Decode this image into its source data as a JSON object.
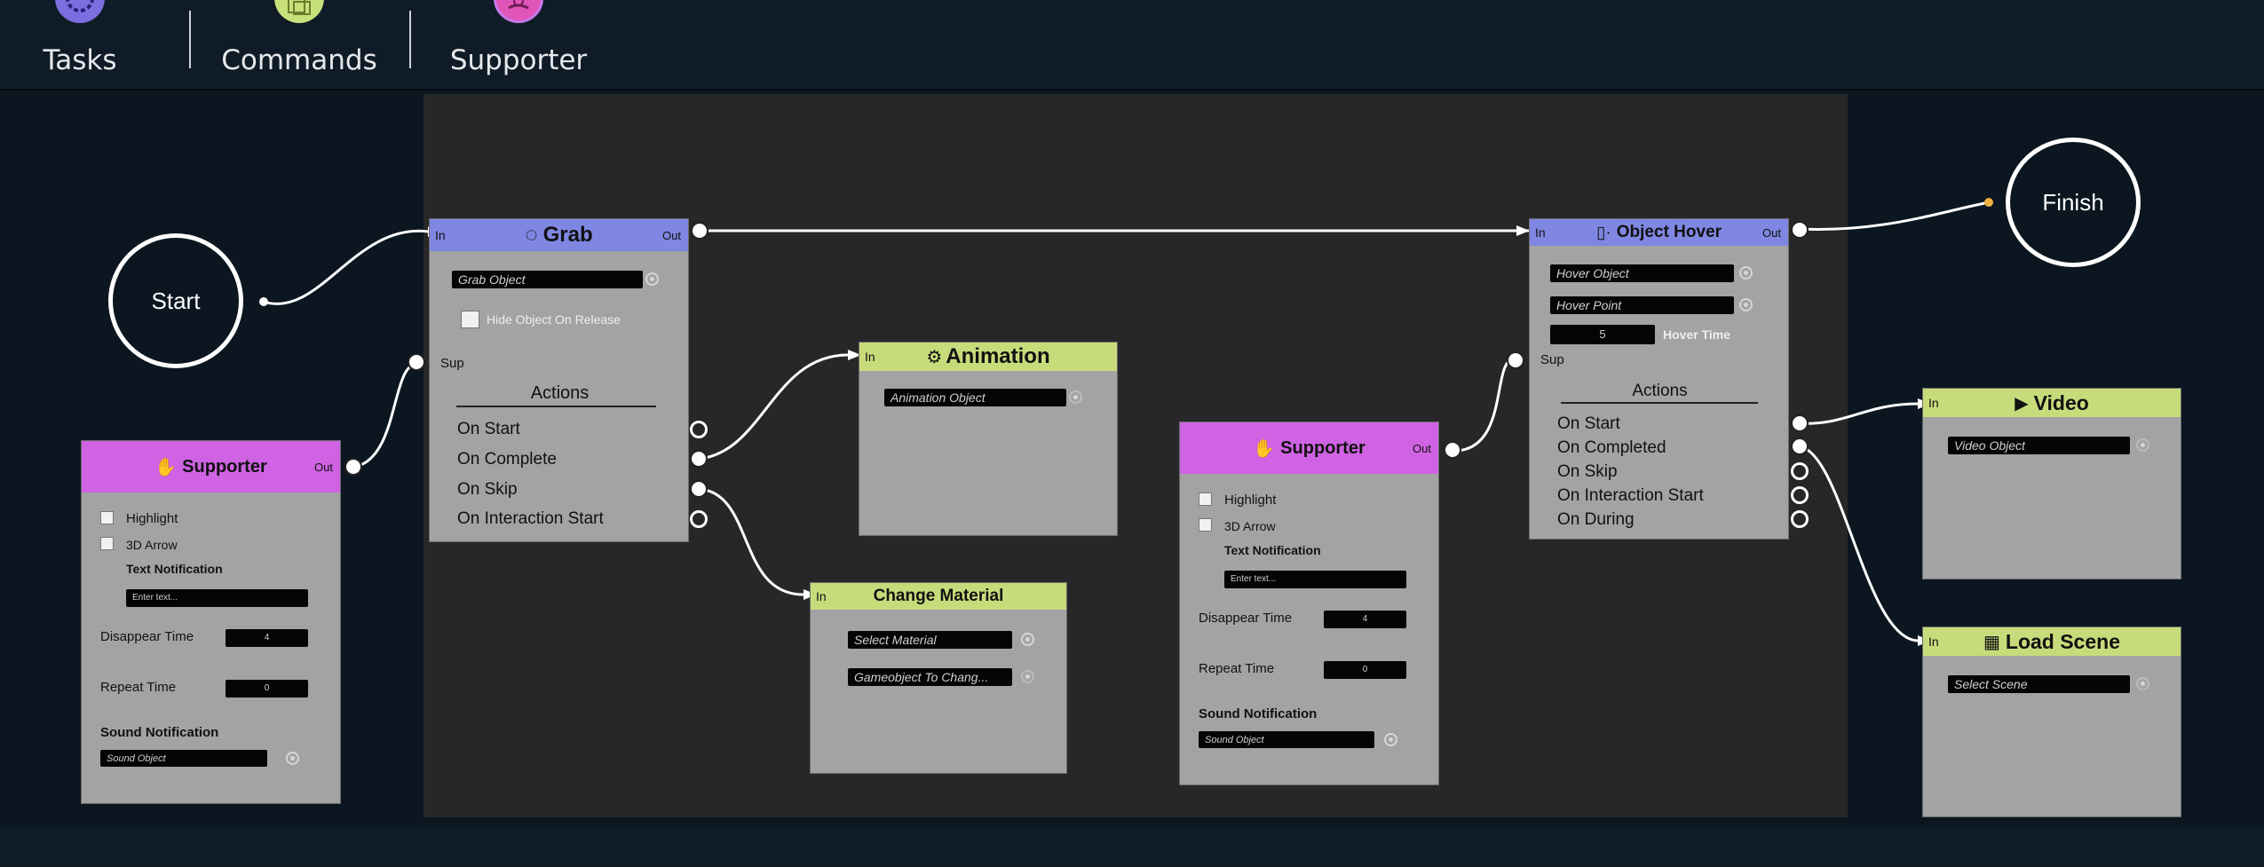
{
  "topbar": {
    "tabs": [
      {
        "label": "Tasks",
        "icon": "gear-icon",
        "color": "#7b6fe0"
      },
      {
        "label": "Commands",
        "icon": "layers-icon",
        "color": "#c8e07a"
      },
      {
        "label": "Supporter",
        "icon": "helping-hand-icon",
        "color": "#e255b8"
      }
    ]
  },
  "flow": {
    "start_label": "Start",
    "finish_label": "Finish"
  },
  "grab": {
    "title": "Grab",
    "icon": "grab-icon",
    "in": "In",
    "out": "Out",
    "object_placeholder": "Grab Object",
    "hide_label": "Hide Object On Release",
    "sup": "Sup",
    "actions_title": "Actions",
    "actions": [
      "On Start",
      "On Complete",
      "On Skip",
      "On Interaction Start"
    ]
  },
  "animation": {
    "title": "Animation",
    "icon": "animation-icon",
    "in": "In",
    "object_placeholder": "Animation Object"
  },
  "change_material": {
    "title": "Change Material",
    "in": "In",
    "material_placeholder": "Select Material",
    "target_placeholder": "Gameobject To Chang..."
  },
  "supporter_left": {
    "title": "Supporter",
    "icon": "helping-hand-icon",
    "out": "Out",
    "highlight": "Highlight",
    "arrow": "3D Arrow",
    "text_notification": "Text Notification",
    "text_placeholder": "Enter text...",
    "disappear_label": "Disappear Time",
    "disappear_value": "4",
    "repeat_label": "Repeat Time",
    "repeat_value": "0",
    "sound_label": "Sound Notification",
    "sound_placeholder": "Sound Object"
  },
  "supporter_mid": {
    "title": "Supporter",
    "icon": "helping-hand-icon",
    "out": "Out",
    "highlight": "Highlight",
    "arrow": "3D Arrow",
    "text_notification": "Text Notification",
    "text_placeholder": "Enter text...",
    "disappear_label": "Disappear Time",
    "disappear_value": "4",
    "repeat_label": "Repeat Time",
    "repeat_value": "0",
    "sound_label": "Sound Notification",
    "sound_placeholder": "Sound Object"
  },
  "object_hover": {
    "title": "Object Hover",
    "icon": "hover-icon",
    "in": "In",
    "out": "Out",
    "hover_object_placeholder": "Hover Object",
    "hover_point_placeholder": "Hover Point",
    "hover_time_value": "5",
    "hover_time_label": "Hover Time",
    "sup": "Sup",
    "actions_title": "Actions",
    "actions": [
      "On Start",
      "On Completed",
      "On Skip",
      "On Interaction Start",
      "On During"
    ]
  },
  "video": {
    "title": "Video",
    "icon": "play-circle-icon",
    "in": "In",
    "object_placeholder": "Video Object"
  },
  "load_scene": {
    "title": "Load Scene",
    "icon": "clapperboard-icon",
    "in": "In",
    "scene_placeholder": "Select Scene"
  }
}
